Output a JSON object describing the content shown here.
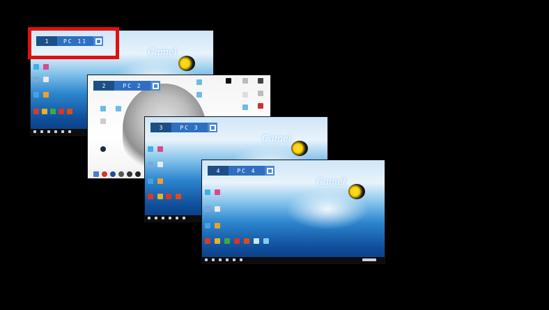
{
  "screens": [
    {
      "number": "1",
      "name": "PC 11",
      "logo": "Camel"
    },
    {
      "number": "2",
      "name": "PC 2"
    },
    {
      "number": "3",
      "name": "PC 3",
      "logo": "Camel"
    },
    {
      "number": "4",
      "name": "PC 4",
      "logo": "Camel"
    }
  ],
  "colors": {
    "highlight": "#e21010",
    "label_number_bg": "#1d4f86",
    "label_name_bg": "#2f6fc0",
    "background": "#000000"
  }
}
